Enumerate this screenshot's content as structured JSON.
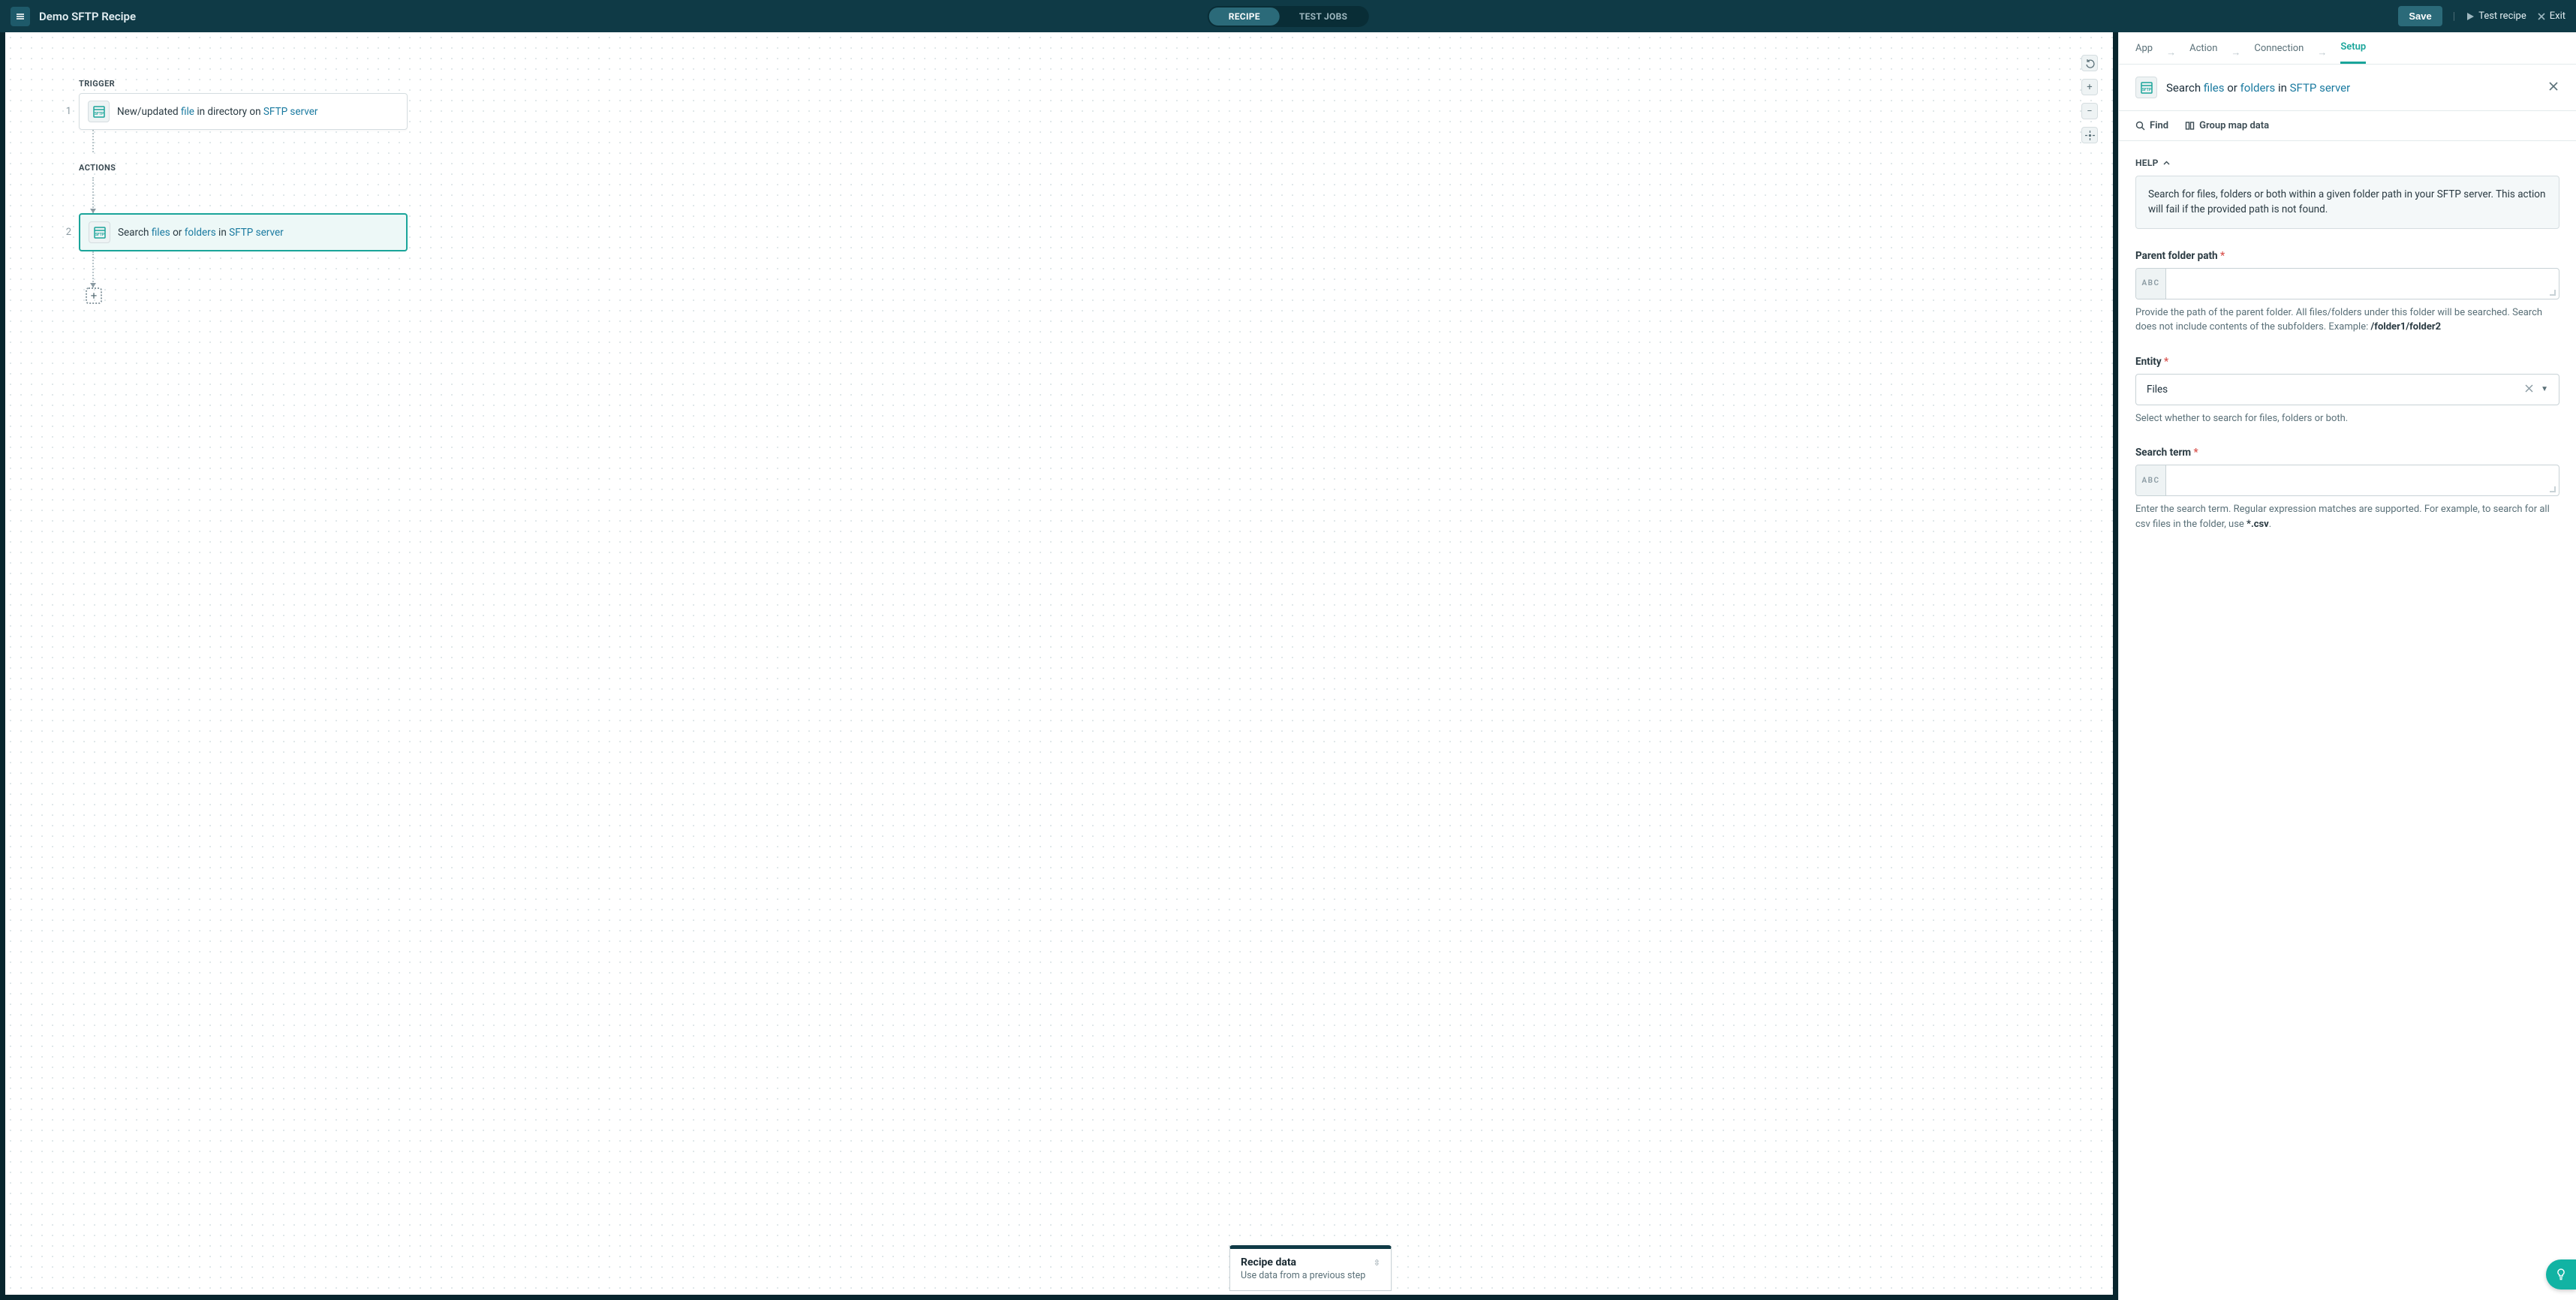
{
  "header": {
    "title": "Demo SFTP Recipe",
    "segment": {
      "recipe": "RECIPE",
      "test_jobs": "TEST JOBS"
    },
    "save": "Save",
    "test_recipe": "Test recipe",
    "exit": "Exit"
  },
  "canvas": {
    "trigger_label": "TRIGGER",
    "actions_label": "ACTIONS",
    "step1": {
      "num": "1",
      "prefix": "New/updated ",
      "file": "file",
      "mid": " in directory on ",
      "server": "SFTP server"
    },
    "step2": {
      "num": "2",
      "prefix": "Search ",
      "files": "files",
      "or": " or ",
      "folders": "folders",
      "in": " in ",
      "server": "SFTP server"
    },
    "recipe_data": {
      "title": "Recipe data",
      "sub": "Use data from a previous step"
    }
  },
  "panel": {
    "tabs": {
      "app": "App",
      "action": "Action",
      "connection": "Connection",
      "setup": "Setup"
    },
    "head": {
      "prefix": "Search ",
      "files": "files",
      "or": " or ",
      "folders": "folders",
      "in": " in ",
      "server": "SFTP server"
    },
    "sub": {
      "find": "Find",
      "group": "Group map data"
    },
    "help_label": "HELP",
    "help_text": "Search for files, folders or both within a given folder path in your SFTP server. This action will fail if the provided path is not found.",
    "parent": {
      "label": "Parent folder path",
      "help_a": "Provide the path of the parent folder. All files/folders under this folder will be searched. Search does not include contents of the subfolders. Example: ",
      "help_b": "/folder1/folder2",
      "prefix": "ABC"
    },
    "entity": {
      "label": "Entity",
      "value": "Files",
      "help": "Select whether to search for files, folders or both."
    },
    "search": {
      "label": "Search term",
      "help_a": "Enter the search term. Regular expression matches are supported. For example, to search for all csv files in the folder, use ",
      "help_b": "*.csv",
      "help_c": ".",
      "prefix": "ABC"
    }
  }
}
